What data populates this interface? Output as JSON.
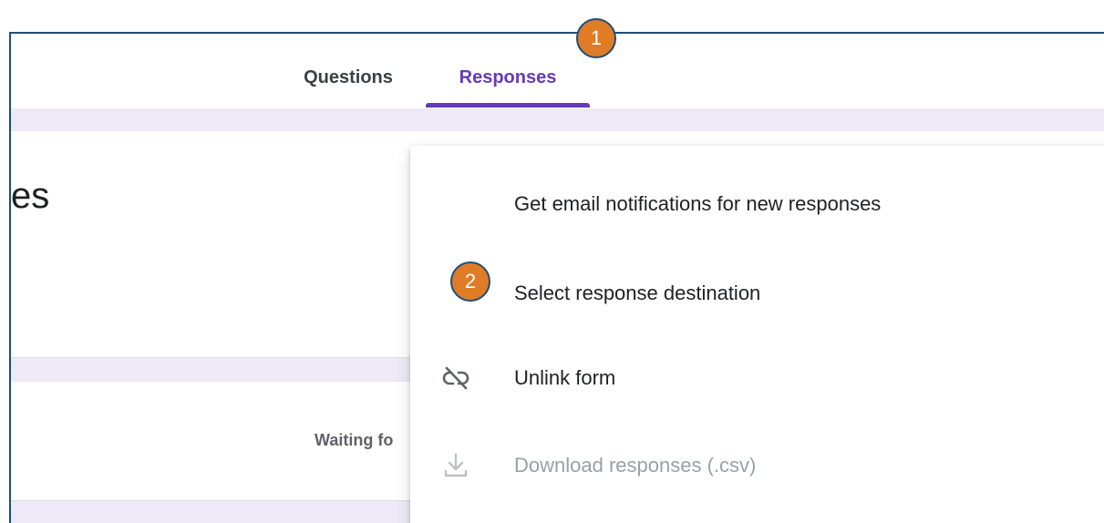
{
  "tabs": {
    "questions_label": "Questions",
    "responses_label": "Responses"
  },
  "page": {
    "title_fragment": "es",
    "waiting_fragment": "Waiting fo"
  },
  "menu": {
    "items": [
      {
        "label": "Get email notifications for new responses",
        "icon": "none"
      },
      {
        "label": "Select response destination",
        "icon": "none"
      },
      {
        "label": "Unlink form",
        "icon": "link-off-icon"
      },
      {
        "label": "Download responses (.csv)",
        "icon": "download-icon",
        "disabled": true
      }
    ]
  },
  "callouts": {
    "one": "1",
    "two": "2"
  },
  "colors": {
    "accent": "#673ab7",
    "callout_fill": "#e07b26",
    "callout_border": "#1f4e79",
    "band": "#ede9f7"
  }
}
